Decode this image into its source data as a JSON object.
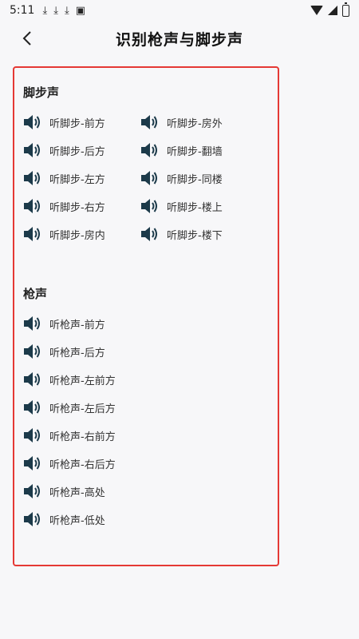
{
  "status_bar": {
    "time": "5:11",
    "icons": [
      "download-icon",
      "download-icon",
      "download-icon",
      "image-icon"
    ]
  },
  "header": {
    "title": "识别枪声与脚步声"
  },
  "footsteps": {
    "heading": "脚步声",
    "items": [
      {
        "label": "听脚步-前方"
      },
      {
        "label": "听脚步-房外"
      },
      {
        "label": "听脚步-后方"
      },
      {
        "label": "听脚步-翻墙"
      },
      {
        "label": "听脚步-左方"
      },
      {
        "label": "听脚步-同楼"
      },
      {
        "label": "听脚步-右方"
      },
      {
        "label": "听脚步-楼上"
      },
      {
        "label": "听脚步-房内"
      },
      {
        "label": "听脚步-楼下"
      }
    ]
  },
  "gunshots": {
    "heading": "枪声",
    "items": [
      {
        "label": "听枪声-前方"
      },
      {
        "label": "听枪声-后方"
      },
      {
        "label": "听枪声-左前方"
      },
      {
        "label": "听枪声-左后方"
      },
      {
        "label": "听枪声-右前方"
      },
      {
        "label": "听枪声-右后方"
      },
      {
        "label": "听枪声-高处"
      },
      {
        "label": "听枪声-低处"
      }
    ]
  },
  "colors": {
    "accent_border": "#e53935",
    "icon": "#1c3a4a"
  }
}
